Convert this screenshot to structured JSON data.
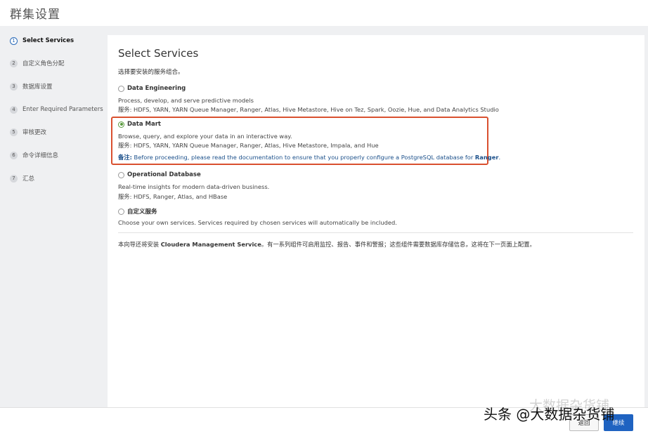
{
  "header": {
    "title": "群集设置"
  },
  "sidebar": {
    "steps": [
      {
        "num": "1",
        "label": "Select Services"
      },
      {
        "num": "2",
        "label": "自定义角色分配"
      },
      {
        "num": "3",
        "label": "数据库设置"
      },
      {
        "num": "4",
        "label": "Enter Required Parameters"
      },
      {
        "num": "5",
        "label": "审核更改"
      },
      {
        "num": "6",
        "label": "命令详细信息"
      },
      {
        "num": "7",
        "label": "汇总"
      }
    ]
  },
  "main": {
    "title": "Select Services",
    "subtitle": "选择要安装的服务组合。",
    "options": [
      {
        "name": "Data Engineering",
        "selected": false,
        "description": "Process, develop, and serve predictive models",
        "services": "服务: HDFS, YARN, YARN Queue Manager, Ranger, Atlas, Hive Metastore, Hive on Tez, Spark, Oozie, Hue, and Data Analytics Studio"
      },
      {
        "name": "Data Mart",
        "selected": true,
        "description": "Browse, query, and explore your data in an interactive way.",
        "services": "服务: HDFS, YARN, YARN Queue Manager, Ranger, Atlas, Hive Metastore, Impala, and Hue",
        "note_label": "备注:",
        "note_text_1": " Before proceeding, please read the ",
        "note_link": "documentation",
        "note_text_2": " to ensure that you properly configure a PostgreSQL database for ",
        "note_bold": "Ranger",
        "note_end": "."
      },
      {
        "name": "Operational Database",
        "selected": false,
        "description": "Real-time insights for modern data-driven business.",
        "services": "服务: HDFS, Ranger, Atlas, and HBase"
      },
      {
        "name": "自定义服务",
        "selected": false,
        "description": "Choose your own services. Services required by chosen services will automatically be included."
      }
    ],
    "footer_pre": "本向导还将安装 ",
    "footer_bold": "Cloudera Management Service",
    "footer_post": "。有一系列组件可启用监控、报告、事件和警报；这些组件需要数据库存储信息，这将在下一页面上配置。"
  },
  "bottom": {
    "back_label": "返回",
    "continue_label": "继续"
  },
  "watermark": {
    "text": "头条 @大数据杂货铺",
    "shadow_text": "大数据杂货铺"
  },
  "colors": {
    "accent": "#1f63c1",
    "highlight_border": "#d9502f",
    "radio_selected": "#5a9a3f"
  }
}
